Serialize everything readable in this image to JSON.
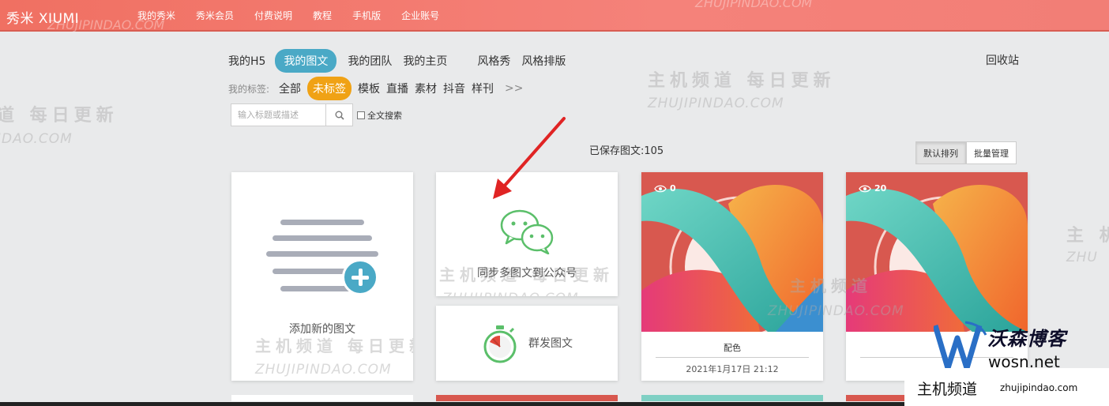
{
  "header": {
    "logo": "秀米 XIUMI",
    "nav": [
      "我的秀米",
      "秀米会员",
      "付费说明",
      "教程",
      "手机版",
      "企业账号"
    ]
  },
  "tabs": [
    "我的H5",
    "我的图文",
    "我的团队",
    "我的主页",
    "风格秀",
    "风格排版"
  ],
  "active_tab": "我的图文",
  "recycle_bin": "回收站",
  "tags": {
    "label": "我的标签:",
    "items": [
      "全部",
      "未标签",
      "模板",
      "直播",
      "素材",
      "抖音",
      "样刊"
    ],
    "active": "未标签",
    "more": ">>"
  },
  "search": {
    "placeholder": "输入标题或描述",
    "fulltext_label": "全文搜索"
  },
  "saved_count": "已保存图文:105",
  "sort_buttons": [
    "默认排列",
    "批量管理"
  ],
  "add_card": {
    "label": "添加新的图文"
  },
  "sync_card": {
    "label": "同步多图文到公众号"
  },
  "mass_card": {
    "label": "群发图文"
  },
  "works": [
    {
      "views": "0",
      "title": "配色",
      "date": "2021年1月17日 21:12"
    },
    {
      "views": "20",
      "title": "",
      "date": ""
    }
  ],
  "watermarks": {
    "cn": "主机频道 每日更新",
    "cn_short": "主机频道",
    "en": "ZHUJIPINDAO.COM",
    "en_partial": "IDAO.COM",
    "cn_partial": "道 每日更新",
    "cn_right": "主 机",
    "en_right": "ZHU"
  },
  "brand": {
    "name": "沃森博客",
    "url": "wosn.net",
    "footer_cn": "主机频道",
    "footer_en": "zhujipindao.com"
  },
  "colors": {
    "header": "#f07062",
    "accent_blue": "#4aa9c6",
    "accent_orange": "#f0a215",
    "wechat_green": "#5bbf6a"
  }
}
